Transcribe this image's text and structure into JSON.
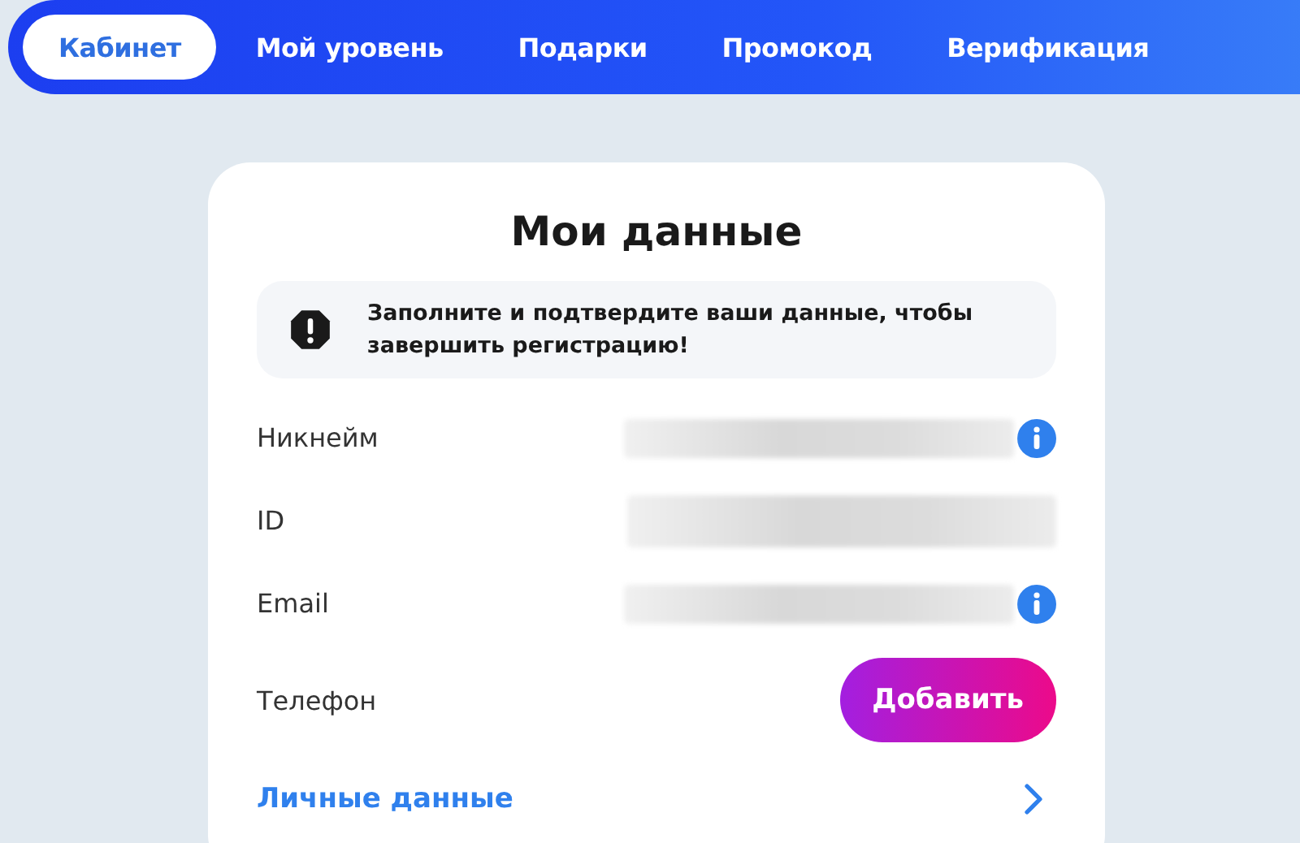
{
  "tabs": [
    {
      "label": "Кабинет",
      "selected": true
    },
    {
      "label": "Мой уровень",
      "selected": false
    },
    {
      "label": "Подарки",
      "selected": false
    },
    {
      "label": "Промокод",
      "selected": false
    },
    {
      "label": "Верификация",
      "selected": false
    }
  ],
  "card": {
    "title": "Мои данные",
    "notice": "Заполните и подтвердите ваши данные, чтобы завершить регистрацию!",
    "rows": [
      {
        "label": "Никнейм",
        "kind": "redacted",
        "info": true
      },
      {
        "label": "ID",
        "kind": "redacted",
        "info": false
      },
      {
        "label": "Email",
        "kind": "redacted",
        "info": true
      },
      {
        "label": "Телефон",
        "kind": "button",
        "button": "Добавить"
      }
    ],
    "link": "Личные данные"
  }
}
